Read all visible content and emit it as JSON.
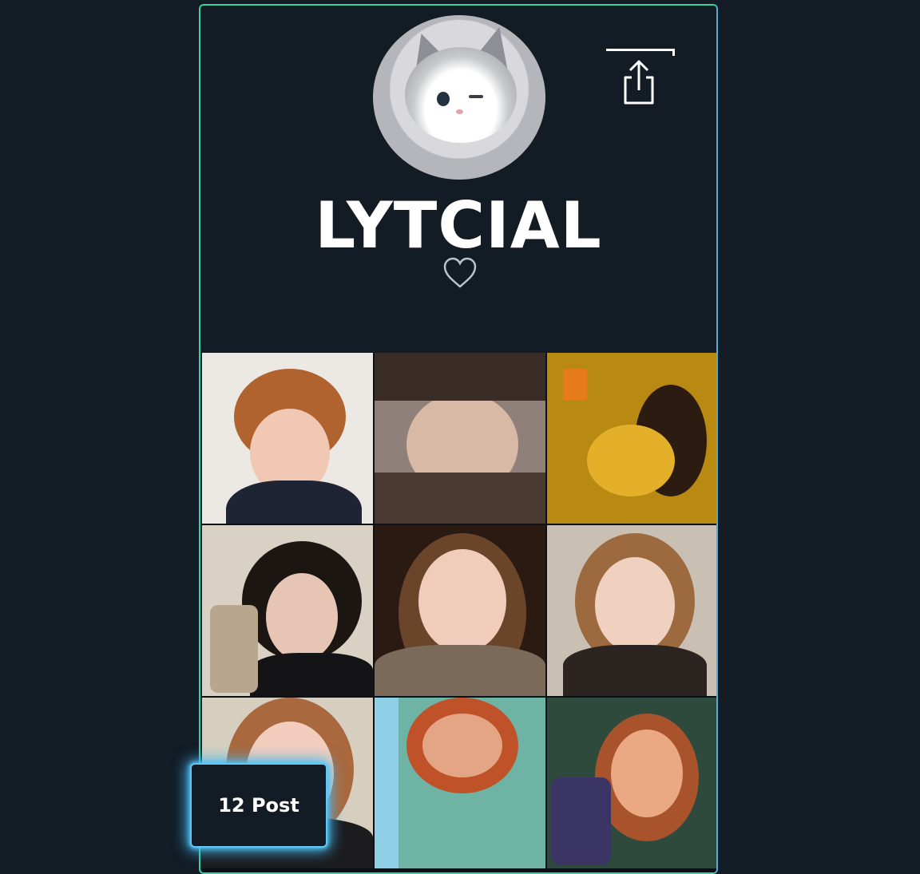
{
  "profile": {
    "username": "LYTCIAL",
    "posts_label": "12 Post"
  },
  "icons": {
    "share": "share-icon",
    "like": "heart-icon"
  },
  "colors": {
    "background": "#131b25",
    "border_accent": "#35d3a0",
    "badge_glow": "#3fb7f0"
  }
}
